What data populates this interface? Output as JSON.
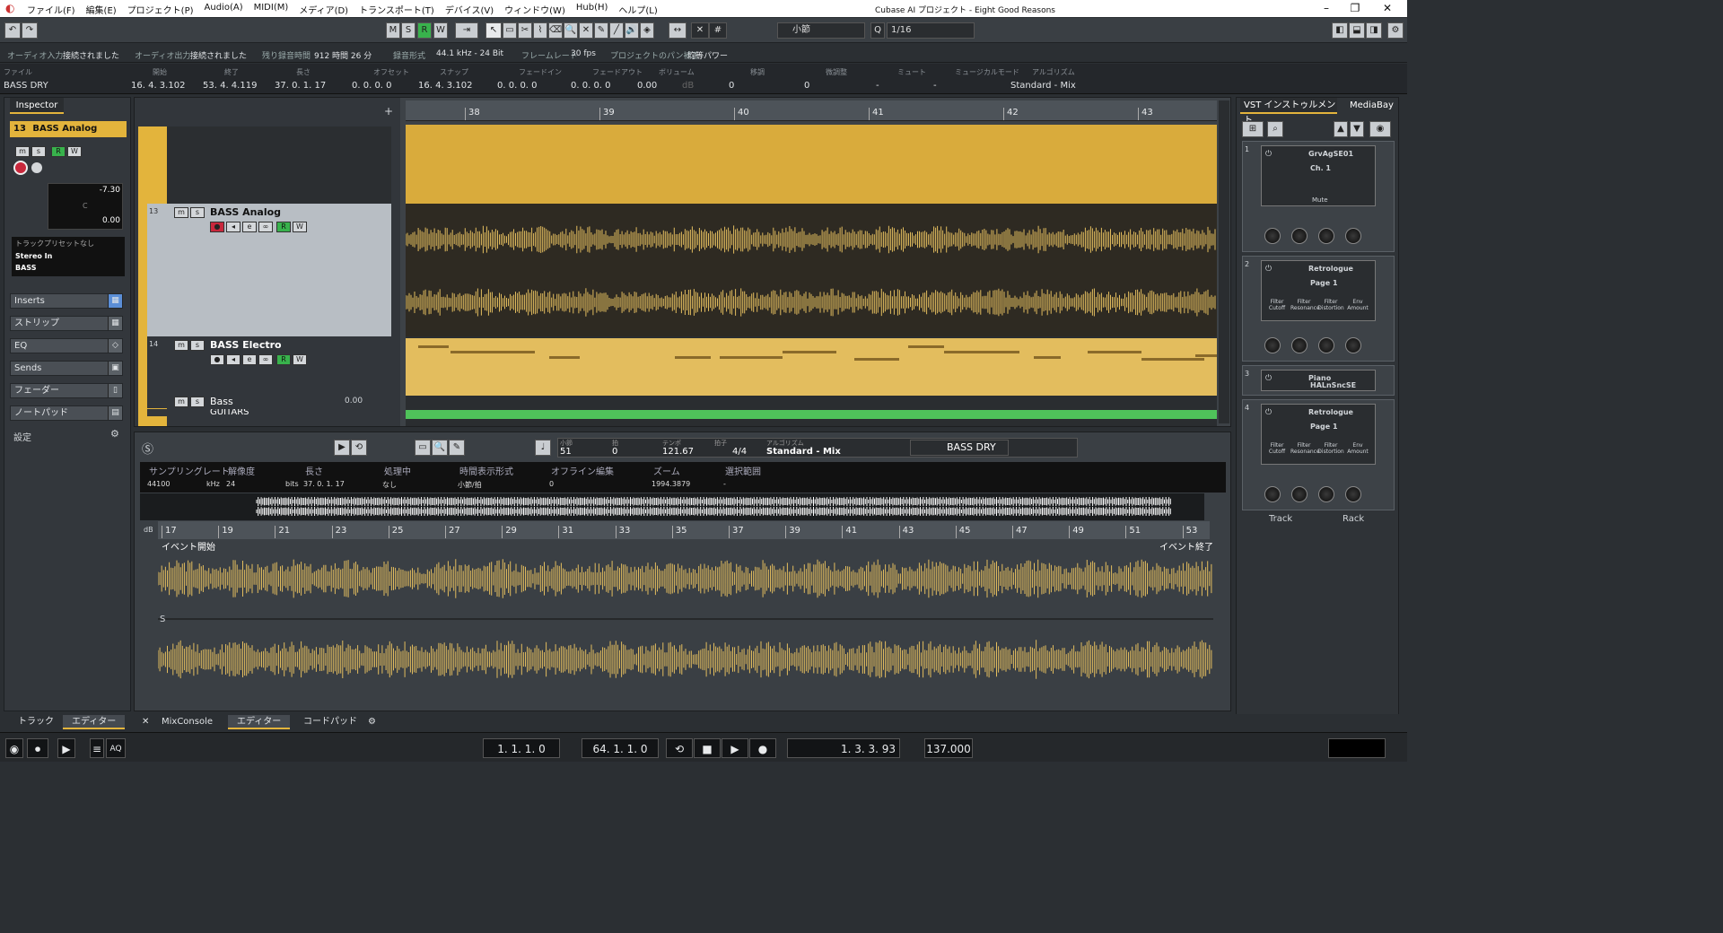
{
  "titlebar": {
    "menus": [
      "ファイル(F)",
      "編集(E)",
      "プロジェクト(P)",
      "Audio(A)",
      "MIDI(M)",
      "メディア(D)",
      "トランスポート(T)",
      "デバイス(V)",
      "ウィンドウ(W)",
      "Hub(H)",
      "ヘルプ(L)"
    ],
    "title": "Cubase AI プロジェクト - Eight Good Reasons"
  },
  "toolbar": {
    "m": "M",
    "s": "S",
    "r": "R",
    "w": "W",
    "grid": "小節",
    "q": "Q",
    "quantize": "1/16"
  },
  "status": {
    "audio_in_label": "オーディオ入力",
    "audio_in": "接続されました",
    "audio_out_label": "オーディオ出力",
    "audio_out": "接続されました",
    "rec_time_label": "残り録音時間",
    "rec_time": "912 時間 26 分",
    "rec_fmt_label": "録音形式",
    "rec_fmt": "44.1 kHz - 24 Bit",
    "fps_label": "フレームレート",
    "fps": "30 fps",
    "pan_label": "プロジェクトのパン補正",
    "pan": "均等パワー"
  },
  "infoline": {
    "file_label": "ファイル",
    "file": "BASS DRY",
    "cols": [
      {
        "l": "開始",
        "v": "16. 4. 3.102"
      },
      {
        "l": "終了",
        "v": "53. 4. 4.119"
      },
      {
        "l": "長さ",
        "v": "37. 0. 1. 17"
      },
      {
        "l": "オフセット",
        "v": "0. 0. 0. 0"
      },
      {
        "l": "スナップ",
        "v": "16. 4. 3.102"
      },
      {
        "l": "フェードイン",
        "v": "0. 0. 0. 0"
      },
      {
        "l": "フェードアウト",
        "v": "0. 0. 0. 0"
      },
      {
        "l": "ボリューム",
        "v": "0.00"
      },
      {
        "l": "移調",
        "v": "0"
      },
      {
        "l": "微調整",
        "v": "0"
      },
      {
        "l": "ミュート",
        "v": "-"
      },
      {
        "l": "ミュージカルモード",
        "v": "-"
      },
      {
        "l": "アルゴリズム",
        "v": "Standard - Mix"
      }
    ],
    "db": "dB"
  },
  "inspector": {
    "tab": "Inspector",
    "track_num": "13",
    "track_name": "BASS Analog",
    "vol": "-7.30",
    "pan": "C",
    "delay": "0.00",
    "preset": "トラックプリセットなし",
    "input": "Stereo In",
    "output": "BASS",
    "sections": [
      "Inserts",
      "ストリップ",
      "EQ",
      "Sends",
      "フェーダー",
      "ノートパッド"
    ],
    "settings": "設定"
  },
  "tracks": [
    {
      "num": "13",
      "name": "BASS Analog"
    },
    {
      "num": "14",
      "name": "BASS Electro"
    },
    {
      "num": "",
      "name": "Bass",
      "val": "0.00"
    },
    {
      "num": "",
      "name": "GUITARS"
    }
  ],
  "ruler": [
    "38",
    "39",
    "40",
    "41",
    "42",
    "43"
  ],
  "editor": {
    "bar": "51",
    "beat": "0",
    "tempo": "121.67",
    "sig": "4/4",
    "tempo_label": "テンポ",
    "sig_label": "拍子",
    "bar_label": "小節",
    "beat_label": "拍",
    "algo_label": "アルゴリズム",
    "algo": "Standard - Mix",
    "clip": "BASS DRY",
    "info": [
      {
        "l": "サンプリングレート",
        "v": "44100",
        "u": "kHz"
      },
      {
        "l": "解像度",
        "v": "24",
        "u": "bits"
      },
      {
        "l": "長さ",
        "v": "37. 0. 1. 17"
      },
      {
        "l": "処理中",
        "v": "なし"
      },
      {
        "l": "時間表示形式",
        "v": "小節/拍"
      },
      {
        "l": "オフライン編集",
        "v": "0"
      },
      {
        "l": "ズーム",
        "v": "1994.3879"
      },
      {
        "l": "選択範囲",
        "v": "-"
      }
    ],
    "ruler": [
      "17",
      "19",
      "21",
      "23",
      "25",
      "27",
      "29",
      "31",
      "33",
      "35",
      "37",
      "39",
      "41",
      "43",
      "45",
      "47",
      "49",
      "51",
      "53"
    ],
    "event_start": "イベント開始",
    "event_end": "イベント終了",
    "db": "dB",
    "s": "S"
  },
  "right": {
    "tab1": "VST インストゥルメント",
    "tab2": "MediaBay",
    "slots": [
      {
        "n": "1",
        "name": "GrvAgSE01",
        "sub": "Ch. 1",
        "extra": "Mute"
      },
      {
        "n": "2",
        "name": "Retrologue",
        "sub": "Page 1",
        "labels": [
          "Filter Cutoff",
          "Filter Resonance",
          "Filter Distortion",
          "Env Amount"
        ]
      },
      {
        "n": "3",
        "name": "Piano",
        "sub": "HALnSncSE"
      },
      {
        "n": "4",
        "name": "Retrologue",
        "sub": "Page 1",
        "labels": [
          "Filter Cutoff",
          "Filter Resonance",
          "Filter Distortion",
          "Env Amount"
        ]
      }
    ],
    "track": "Track",
    "rack": "Rack"
  },
  "bottomtabs": [
    "トラック",
    "エディター",
    "MixConsole",
    "エディター",
    "コードパッド"
  ],
  "transport": {
    "left": "1. 1. 1. 0",
    "right": "64. 1. 1. 0",
    "pos": "1. 3. 3. 93",
    "tempo": "137.000",
    "aq": "AQ"
  }
}
